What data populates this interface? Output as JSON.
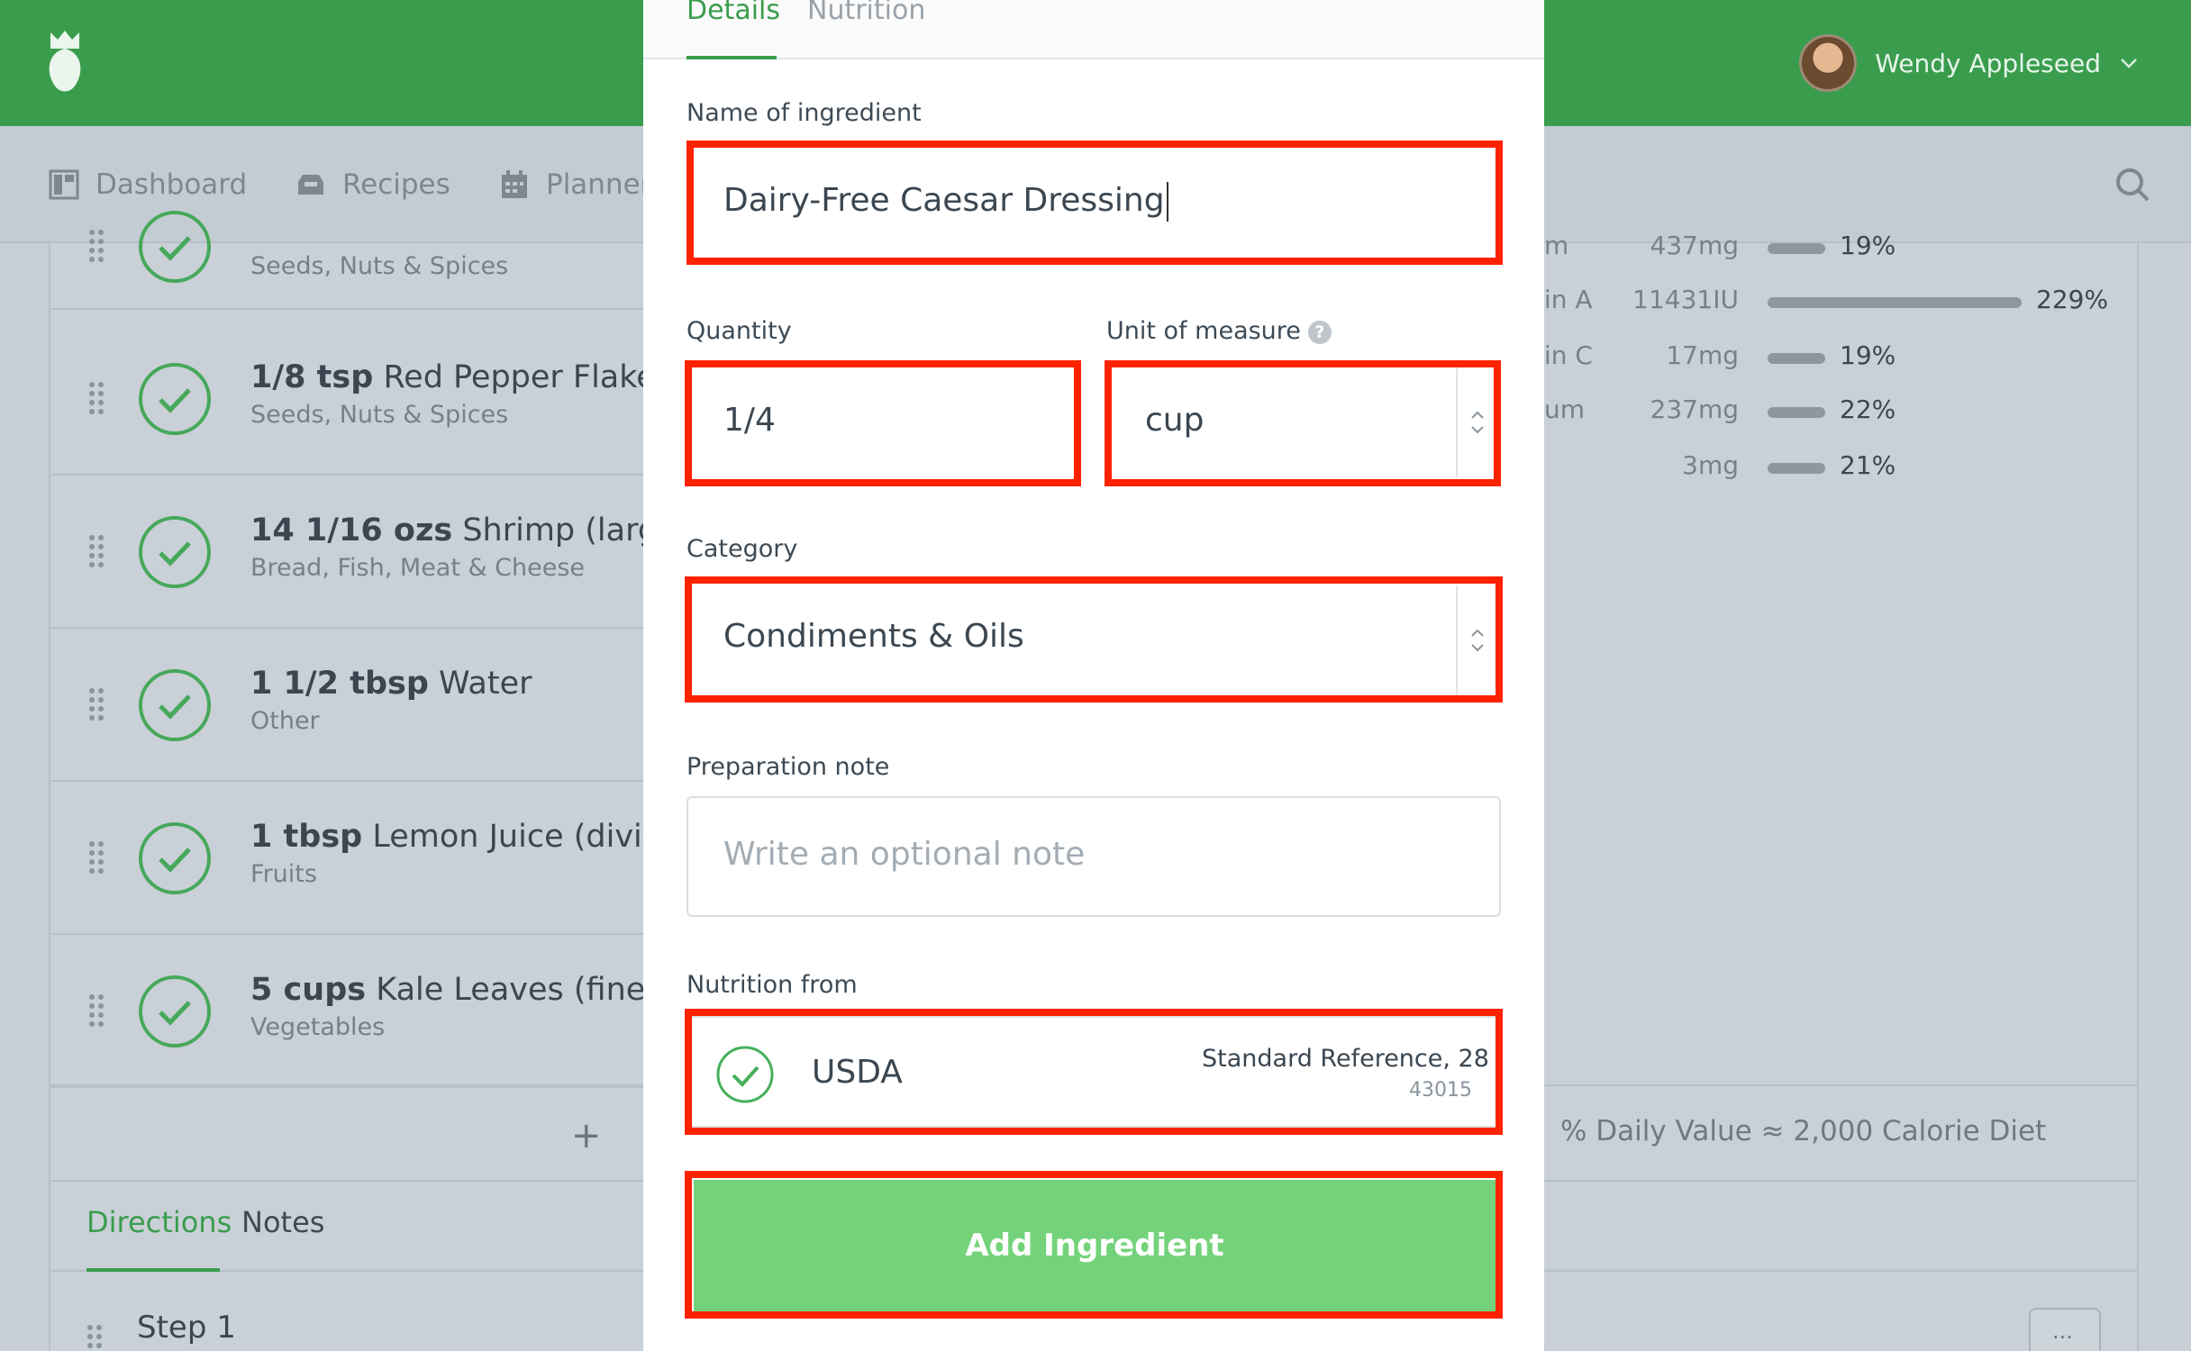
{
  "header": {
    "user_name": "Wendy Appleseed"
  },
  "nav": {
    "items": [
      {
        "label": "Dashboard",
        "icon": "dashboard-icon"
      },
      {
        "label": "Recipes",
        "icon": "recipes-icon"
      },
      {
        "label": "Planner",
        "icon": "calendar-icon"
      }
    ]
  },
  "ingredients": [
    {
      "qty": "",
      "name": "",
      "category": "Seeds, Nuts & Spices"
    },
    {
      "qty": "1/8 tsp",
      "name": "Red Pepper Flakes",
      "category": "Seeds, Nuts & Spices"
    },
    {
      "qty": "14 1/16 ozs",
      "name": "Shrimp (large,",
      "category": "Bread, Fish, Meat & Cheese"
    },
    {
      "qty": "1 1/2 tbsp",
      "name": "Water",
      "category": "Other"
    },
    {
      "qty": "1 tbsp",
      "name": "Lemon Juice (divide",
      "category": "Fruits"
    },
    {
      "qty": "5 cups",
      "name": "Kale Leaves (finely c",
      "category": "Vegetables"
    }
  ],
  "nutrition_rows": [
    {
      "name": "m",
      "amount": "437mg",
      "percent": "19%",
      "fraction": 0.08
    },
    {
      "name": "in A",
      "amount": "11431IU",
      "percent": "229%",
      "fraction": 1.0
    },
    {
      "name": "in C",
      "amount": "17mg",
      "percent": "19%",
      "fraction": 0.08
    },
    {
      "name": "um",
      "amount": "237mg",
      "percent": "22%",
      "fraction": 0.1
    },
    {
      "name": "",
      "amount": "3mg",
      "percent": "21%",
      "fraction": 0.09
    }
  ],
  "daily_value_note": "% Daily Value ≈ 2,000 Calorie Diet",
  "add_row_symbol": "+",
  "bottom_tabs": {
    "directions": "Directions",
    "notes": "Notes"
  },
  "step_label": "Step 1",
  "more_label": "...",
  "modal": {
    "tabs": {
      "details": "Details",
      "nutrition": "Nutrition"
    },
    "name_label": "Name of ingredient",
    "name_value": "Dairy-Free Caesar Dressing",
    "quantity_label": "Quantity",
    "quantity_value": "1/4",
    "unit_label": "Unit of measure",
    "unit_help": "?",
    "unit_value": "cup",
    "category_label": "Category",
    "category_value": "Condiments & Oils",
    "prep_label": "Preparation note",
    "prep_placeholder": "Write an optional note",
    "nutrition_from_label": "Nutrition from",
    "nutrition_source": "USDA",
    "nutrition_reference": "Standard Reference, 28",
    "nutrition_code": "43015",
    "add_button": "Add Ingredient"
  },
  "colors": {
    "brand_green": "#3a9d4e",
    "button_green": "#74d37a",
    "highlight_red": "#ff2200"
  }
}
